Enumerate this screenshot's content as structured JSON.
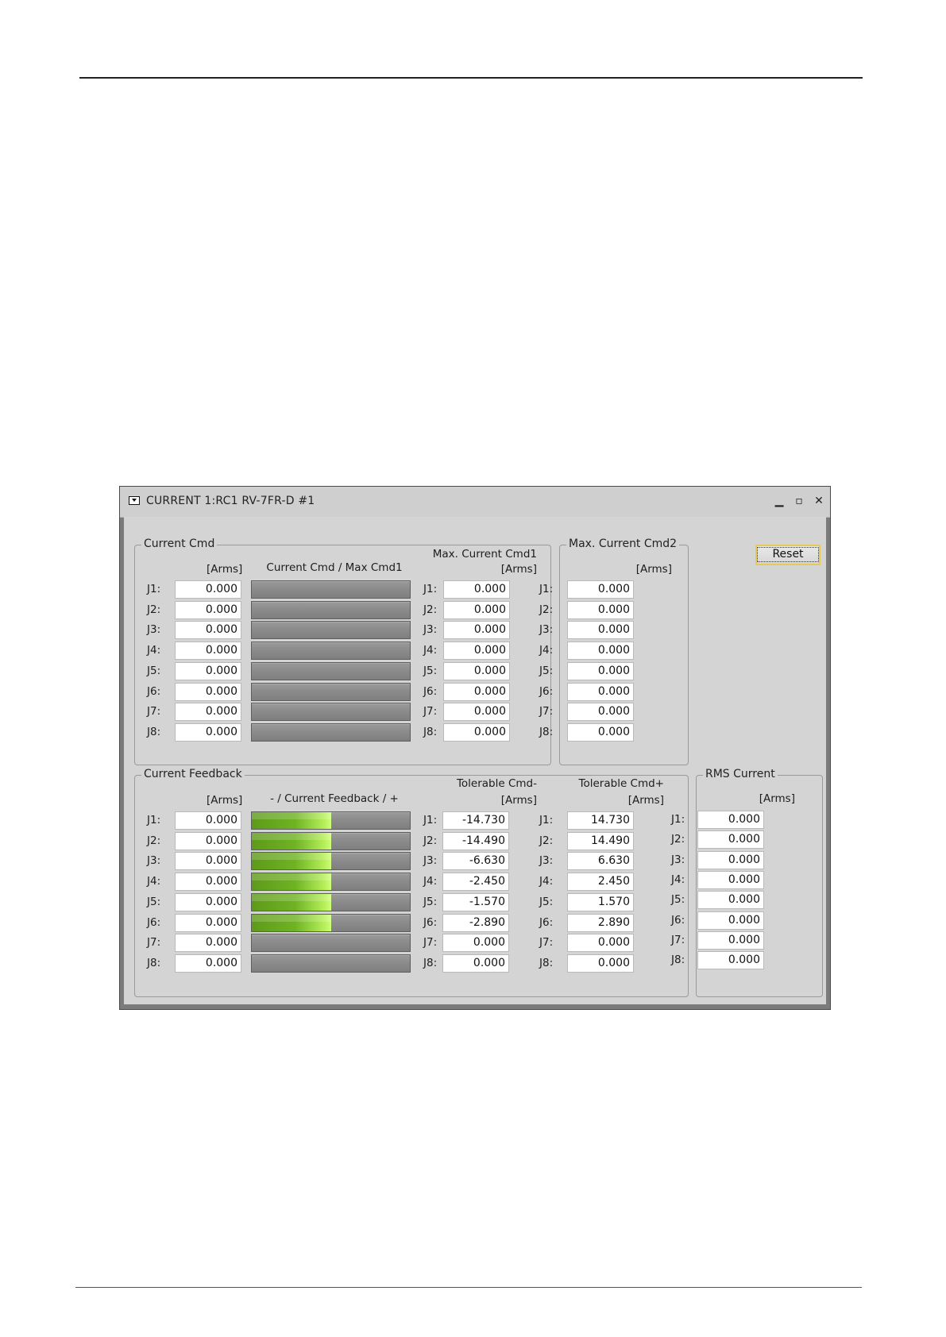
{
  "window": {
    "title": "CURRENT 1:RC1 RV-7FR-D #1",
    "controls": {
      "minimize": "▁",
      "maximize": "▫",
      "close": "✕"
    }
  },
  "reset_button": {
    "label": "Reset"
  },
  "joint_labels": [
    "J1:",
    "J2:",
    "J3:",
    "J4:",
    "J5:",
    "J6:",
    "J7:",
    "J8:"
  ],
  "current_cmd": {
    "title": "Current Cmd",
    "unit_label": "[Arms]",
    "bar_header": "Current Cmd / Max Cmd1",
    "values": [
      "0.000",
      "0.000",
      "0.000",
      "0.000",
      "0.000",
      "0.000",
      "0.000",
      "0.000"
    ],
    "bar_levels": [
      0,
      0,
      0,
      0,
      0,
      0,
      0,
      0
    ],
    "max_header": "Max. Current Cmd1",
    "max_unit_label": "[Arms]",
    "max_values": [
      "0.000",
      "0.000",
      "0.000",
      "0.000",
      "0.000",
      "0.000",
      "0.000",
      "0.000"
    ]
  },
  "max_current_cmd2": {
    "title": "Max. Current Cmd2",
    "unit_label": "[Arms]",
    "values": [
      "0.000",
      "0.000",
      "0.000",
      "0.000",
      "0.000",
      "0.000",
      "0.000",
      "0.000"
    ]
  },
  "current_feedback": {
    "title": "Current Feedback",
    "unit_label": "[Arms]",
    "bar_header": "- / Current Feedback / +",
    "values": [
      "0.000",
      "0.000",
      "0.000",
      "0.000",
      "0.000",
      "0.000",
      "0.000",
      "0.000"
    ],
    "bar_levels": [
      0.5,
      0.5,
      0.5,
      0.5,
      0.5,
      0.5,
      0,
      0
    ],
    "tol_minus_header": "Tolerable Cmd-",
    "tol_minus_unit": "[Arms]",
    "tol_minus_values": [
      "-14.730",
      "-14.490",
      "-6.630",
      "-2.450",
      "-1.570",
      "-2.890",
      "0.000",
      "0.000"
    ],
    "tol_plus_header": "Tolerable Cmd+",
    "tol_plus_unit": "[Arms]",
    "tol_plus_values": [
      "14.730",
      "14.490",
      "6.630",
      "2.450",
      "1.570",
      "2.890",
      "0.000",
      "0.000"
    ]
  },
  "rms_current": {
    "title": "RMS Current",
    "unit_label": "[Arms]",
    "values": [
      "0.000",
      "0.000",
      "0.000",
      "0.000",
      "0.000",
      "0.000",
      "0.000",
      "0.000"
    ]
  }
}
